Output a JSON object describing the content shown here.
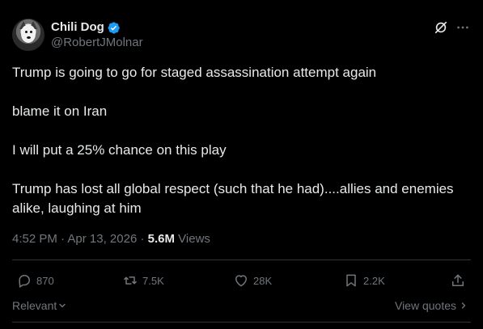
{
  "author": {
    "display_name": "Chili Dog",
    "handle": "@RobertJMolnar",
    "verified": true
  },
  "icons": {
    "verified": "verified-badge-icon",
    "grok": "grok-icon",
    "more": "more-options-icon",
    "reply": "reply-icon",
    "repost": "repost-icon",
    "like": "like-icon",
    "bookmark": "bookmark-icon",
    "share": "share-icon"
  },
  "tweet": {
    "paragraphs": [
      "Trump is going to go for staged assassination attempt again",
      "blame it on Iran",
      "I will put a 25% chance on this play",
      "Trump has lost all global respect (such that he had)....allies and enemies alike, laughing at him"
    ],
    "time": "4:52 PM",
    "date": "Apr 13, 2026",
    "views_count": "5.6M",
    "views_label": "Views"
  },
  "actions": {
    "replies": "870",
    "reposts": "7.5K",
    "likes": "28K",
    "bookmarks": "2.2K"
  },
  "footer": {
    "sort_label": "Relevant",
    "quotes_label": "View quotes"
  },
  "colors": {
    "background": "#000000",
    "text_primary": "#e7e9ea",
    "text_secondary": "#71767b",
    "verified_blue": "#1d9bf0",
    "divider": "#2f3336"
  }
}
